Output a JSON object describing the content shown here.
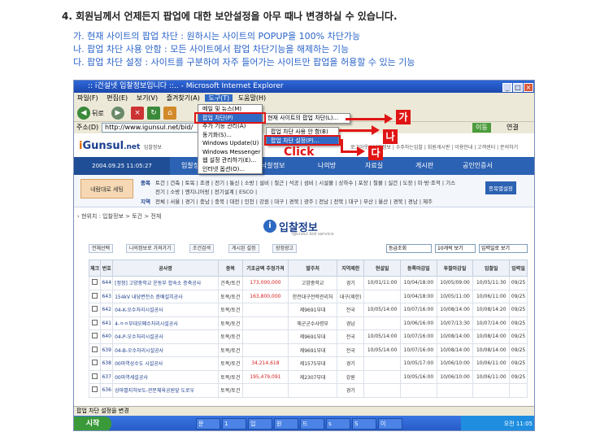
{
  "heading": "4. 회원님께서 언제든지 팝업에 대한 보안설정을 아무 때나 변경하실 수 있습니다.",
  "descriptions": [
    "가. 현재 사이트의 팝업 차단 : 원하시는 사이트의 POPUP을 100% 차단가능",
    "나. 팝업 차단 사용 안함 : 모든 사이트에서 팝업 차단기능을 해제하는 기능",
    "다. 팝업 차단 설정 : 사이트를 구분하여 자주 들어가는 사이트만 팝업을 허용할 수 있는 기능"
  ],
  "browser": {
    "title": ":: i건설넷 입찰정보입니다 ::.. - Microsoft Internet Explorer",
    "menu": [
      "파일(F)",
      "편집(E)",
      "보기(V)",
      "즐겨찾기(A)",
      "도구(T)",
      "도움말(H)"
    ],
    "back": "뒤로",
    "address_label": "주소(D)",
    "address": "http://www.igunsul.net/bid/",
    "go": "이동",
    "links": "연결"
  },
  "tools_menu": [
    "메일 및 뉴스(M)",
    "팝업 차단(P)",
    "추가 기능 관리(A)",
    "동기화(S)...",
    "Windows Update(U)",
    "Windows Messenger",
    "웹 설정 관리하기(E)...",
    "인터넷 옵션(O)..."
  ],
  "popup_submenu": [
    "현재 사이트의 팝업 차단(L)...",
    "팝업 차단 사용 안 함(B)",
    "팝업 차단 설정(P)..."
  ],
  "markers": {
    "a": "가",
    "b": "나",
    "c": "다",
    "click": "Click"
  },
  "site": {
    "logo_main": "Gunsul",
    "logo_dot": ".net",
    "logo_tag": "입찰정보",
    "top_links": "로그아웃 | 나의정보 | 수주하는입찰 | 회원게시판 | 이용안내 | 고객센터 | 문의하기",
    "datetime": "2004.09.25 11:05:27",
    "nav": [
      "입찰정보",
      "낙찰정보",
      "나의방",
      "자료실",
      "게시판",
      "공인인증서"
    ],
    "region_label_1": "종목",
    "region_label_2": "지역",
    "region_items_1": "토건 | 건축 | 토목 | 조경 | 전기 | 통신 | 소방 | 설비 | 철근 | 석공 | 섬비 | 시설물 | 상하수 | 포장 | 철물 | 실건 | 도장 | 미·방·조적 | 기스",
    "region_items_1b": "전기 | 소방 | 엔지니어링 | 전기설계 | ESCO |",
    "region_items_2": "전체 | 서울 | 경기 | 충남 | 충북 | 대전 | 인천 | 강원 | 대구 | 경북 | 광주 | 전남 | 전북 | 대구 | 부산 | 울산 | 경북 | 경남 | 제주",
    "login_button": "내람대로 세팅",
    "side_button": "종목별설정",
    "breadcrumb": "› 현위치 : 입찰정보 > 토건 > 전체",
    "page_title": "입찰정보",
    "page_subtitle": "igunsul bid service",
    "controls": [
      "전체선택",
      "나의정보로 가져가기",
      "조건검색",
      "게시된 설정",
      "장정광고"
    ],
    "sort_select": "등급조회",
    "page_size": "10개씩 보기",
    "order_select": "입력일로 보기",
    "columns": [
      "체크",
      "번호",
      "공사명",
      "종목",
      "기초금액 추정가격",
      "발주처",
      "지역제한",
      "현설일",
      "등록마감일",
      "투찰마감일",
      "입찰일",
      "입력일"
    ],
    "rows": [
      {
        "no": "644",
        "name": "[정정] 고양중학교 운동부 합숙소 증축공사",
        "type": "건축/토건",
        "price": "173,000,000",
        "owner": "고양중학교",
        "region": "경기",
        "site": "10/01/11:00",
        "reg": "10/04/18:00",
        "bid_end": "10/05/09:00",
        "bid": "10/05/11:30",
        "input": "09/25"
      },
      {
        "no": "643",
        "name": "154kV 내당변전소 증배설치공사",
        "type": "토목/토건",
        "price": "163,800,000",
        "owner": "한전대구전력관리처",
        "region": "대구(제한)",
        "site": "",
        "reg": "10/04/18:00",
        "bid_end": "10/05/11:00",
        "bid": "10/06/11:00",
        "input": "09/25"
      },
      {
        "no": "642",
        "name": "04-K-오수처리시설공사",
        "type": "토목/토건",
        "price": "",
        "owner": "제9691부대",
        "region": "전국",
        "site": "10/05/14:00",
        "reg": "10/07/16:00",
        "bid_end": "10/08/14:00",
        "bid": "10/08/14:20",
        "input": "09/25"
      },
      {
        "no": "641",
        "name": "4-ㅇㅇ부대오폐수처리시설공사",
        "type": "토목/토건",
        "price": "",
        "owner": "해군군수사령부",
        "region": "경남",
        "site": "",
        "reg": "10/06/16:00",
        "bid_end": "10/07/13:30",
        "bid": "10/07/14:00",
        "input": "09/25"
      },
      {
        "no": "640",
        "name": "04-P-오수처리시설공사",
        "type": "토목/토건",
        "price": "",
        "owner": "제9691부대",
        "region": "전국",
        "site": "10/05/14:00",
        "reg": "10/07/16:00",
        "bid_end": "10/08/14:00",
        "bid": "10/08/14:00",
        "input": "09/25"
      },
      {
        "no": "639",
        "name": "04-B-오수처리시설공사",
        "type": "토목/토건",
        "price": "",
        "owner": "제9691부대",
        "region": "전국",
        "site": "10/05/14:00",
        "reg": "10/07/16:00",
        "bid_end": "10/08/14:00",
        "bid": "10/08/14:00",
        "input": "09/25"
      },
      {
        "no": "638",
        "name": "00마역상수도 시설공사",
        "type": "토목/토건",
        "price": "34,214,618",
        "owner": "제1575부대",
        "region": "경기",
        "site": "",
        "reg": "10/05/17:00",
        "bid_end": "10/06/10:00",
        "bid": "10/06/11:00",
        "input": "09/25"
      },
      {
        "no": "637",
        "name": "00마역세설공사",
        "type": "토목/토건",
        "price": "195,479,091",
        "owner": "제2307부대",
        "region": "강원",
        "site": "",
        "reg": "10/05/16:00",
        "bid_end": "10/06/10:00",
        "bid": "10/06/11:00",
        "input": "09/25"
      },
      {
        "no": "636",
        "name": "상마별지하보도-관문체육공원앞 도로우",
        "type": "토목/토건",
        "price": "",
        "owner": "",
        "region": "경기",
        "site": "",
        "reg": "",
        "bid_end": "",
        "bid": "",
        "input": ""
      }
    ],
    "status_text": "팝업 차단 설정을 변경"
  },
  "taskbar": {
    "start": "시작",
    "items": [
      "문",
      "1",
      "입",
      "원",
      "드",
      "s",
      "S",
      "이"
    ],
    "clock": "오전 11:05"
  }
}
